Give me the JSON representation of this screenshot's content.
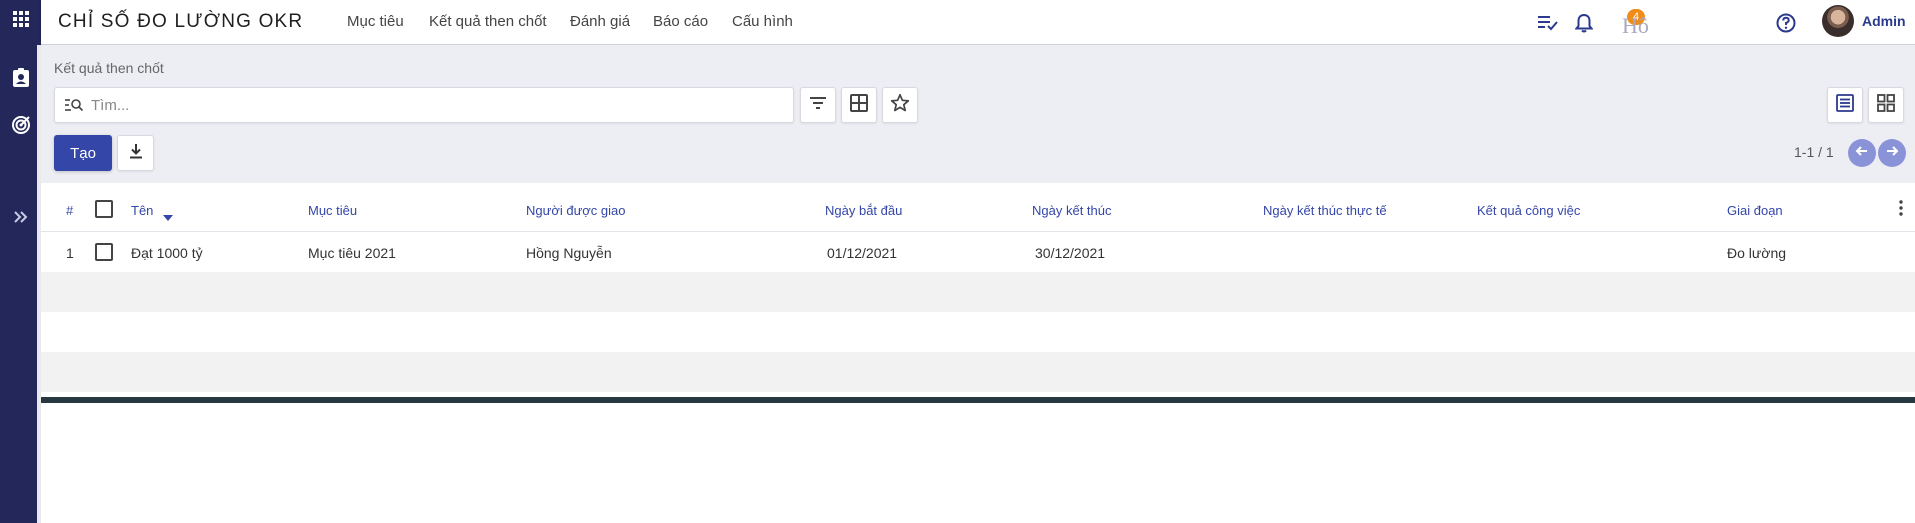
{
  "brand": {
    "title": "CHỈ SỐ ĐO LƯỜNG OKR"
  },
  "nav": [
    {
      "label": "Mục tiêu"
    },
    {
      "label": "Kết quả then chốt"
    },
    {
      "label": "Đánh giá"
    },
    {
      "label": "Báo cáo"
    },
    {
      "label": "Cấu hình"
    }
  ],
  "topbar": {
    "notification_count": "4",
    "company": "Hô",
    "user": "Admin"
  },
  "rail_icons": [
    "apps-grid-icon",
    "contact-badge-icon",
    "target-icon",
    "expand-chevrons-icon"
  ],
  "control_panel": {
    "breadcrumb": "Kết quả then chốt",
    "search_placeholder": "Tìm...",
    "create_label": "Tạo",
    "pager": "1-1 / 1"
  },
  "table": {
    "columns": [
      "#",
      "Tên",
      "Mục tiêu",
      "Người được giao",
      "Ngày bắt đầu",
      "Ngày kết thúc",
      "Ngày kết thúc thực tế",
      "Kết quả công việc",
      "Giai đoạn"
    ],
    "rows": [
      {
        "index": "1",
        "name": "Đạt 1000 tỷ",
        "objective": "Mục tiêu 2021",
        "assignee": "Hồng Nguyễn",
        "start": "01/12/2021",
        "end": "30/12/2021",
        "actual_end": "",
        "result": "",
        "stage": "Đo lường"
      }
    ]
  },
  "colors": {
    "rail": "#23275a",
    "accent": "#3446a8",
    "control_panel_bg": "#edeef4",
    "badge": "#f08c1a",
    "pager_button": "#8a93d8"
  }
}
